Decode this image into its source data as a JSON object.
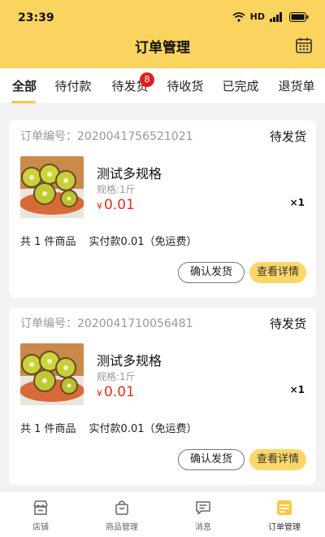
{
  "status_bar": {
    "time": "23:39",
    "network": "HD",
    "signal_label": "4G"
  },
  "header": {
    "title": "订单管理"
  },
  "tabs": [
    {
      "label": "全部",
      "active": true
    },
    {
      "label": "待付款"
    },
    {
      "label": "待发货",
      "badge": "8"
    },
    {
      "label": "待收货"
    },
    {
      "label": "已完成"
    },
    {
      "label": "退货单"
    }
  ],
  "orders": [
    {
      "order_no": "订单编号：2020041756521021",
      "status": "待发货",
      "product_name": "测试多规格",
      "spec": "规格:1斤",
      "currency": "¥",
      "price": "0.01",
      "quantity": "×1",
      "count_text": "共 1 件商品",
      "paid_text": "实付款0.01",
      "shipping_text": "（免运费）",
      "ship_button": "确认发货",
      "detail_button": "查看详情"
    },
    {
      "order_no": "订单编号：2020041710056481",
      "status": "待发货",
      "product_name": "测试多规格",
      "spec": "规格:1斤",
      "currency": "¥",
      "price": "0.01",
      "quantity": "×1",
      "count_text": "共 1 件商品",
      "paid_text": "实付款0.01",
      "shipping_text": "（免运费）",
      "ship_button": "确认发货",
      "detail_button": "查看详情"
    }
  ],
  "tabbar": [
    {
      "label": "店铺",
      "icon": "store-icon"
    },
    {
      "label": "商品管理",
      "icon": "bag-icon"
    },
    {
      "label": "消息",
      "icon": "message-icon"
    },
    {
      "label": "订单管理",
      "icon": "order-icon",
      "active": true
    }
  ],
  "colors": {
    "accent": "#fbd45f",
    "price": "#e0301e",
    "badge": "#e0201e"
  }
}
